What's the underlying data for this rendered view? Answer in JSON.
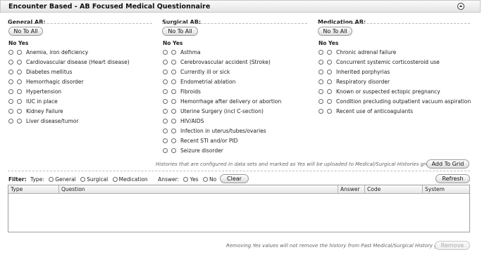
{
  "header": {
    "title": "Encounter Based - AB Focused Medical Questionnaire"
  },
  "columns": [
    {
      "id": "general",
      "title": "General AB:",
      "no_to_all": "No To All",
      "noyes_label": "No Yes",
      "items": [
        "Anemia, iron deficiency",
        "Cardiovascular disease (Heart disease)",
        "Diabetes mellitus",
        "Hemorrhagic disorder",
        "Hypertension",
        "IUC in place",
        "Kidney Failure",
        "Liver disease/tumor"
      ]
    },
    {
      "id": "surgical",
      "title": "Surgical AB:",
      "no_to_all": "No To All",
      "noyes_label": "No Yes",
      "items": [
        "Asthma",
        "Cerebrovascular accident (Stroke)",
        "Currently ill or sick",
        "Endometrial ablation",
        "Fibroids",
        "Hemorrhage after delivery or abortion",
        "Uterine Surgery (incl C-section)",
        "HIV/AIDS",
        "Infection in uterus/tubes/ovaries",
        "Recent STI and/or PID",
        "Seizure disorder"
      ]
    },
    {
      "id": "medication",
      "title": "Medication AB:",
      "no_to_all": "No To All",
      "noyes_label": "No Yes",
      "items": [
        "Chronic adrenal failure",
        "Concurrent systemic corticosteroid use",
        "Inherited porphyrias",
        "Respiratory disorder",
        "Known or suspected ectopic pregnancy",
        "Condition precluding outpatient vacuum aspiration",
        "Recent use of anticoagulants"
      ]
    }
  ],
  "histories_note": "Histories that are configured in data sets and marked as Yes will be uploaded to Medical/Surgical Histories grid",
  "add_to_grid": "Add To Grid",
  "filter": {
    "filter_label": "Filter:",
    "type_label": "Type:",
    "type_options": [
      "General",
      "Surgical",
      "Medication"
    ],
    "answer_label": "Answer:",
    "answer_options": [
      "Yes",
      "No"
    ],
    "clear": "Clear",
    "refresh": "Refresh"
  },
  "grid": {
    "columns": [
      "Type",
      "Question",
      "Answer",
      "Code",
      "System"
    ]
  },
  "remove_note": "Removing Yes values will not remove the history from Past Medical/Surgical History grid",
  "remove": "Remove"
}
